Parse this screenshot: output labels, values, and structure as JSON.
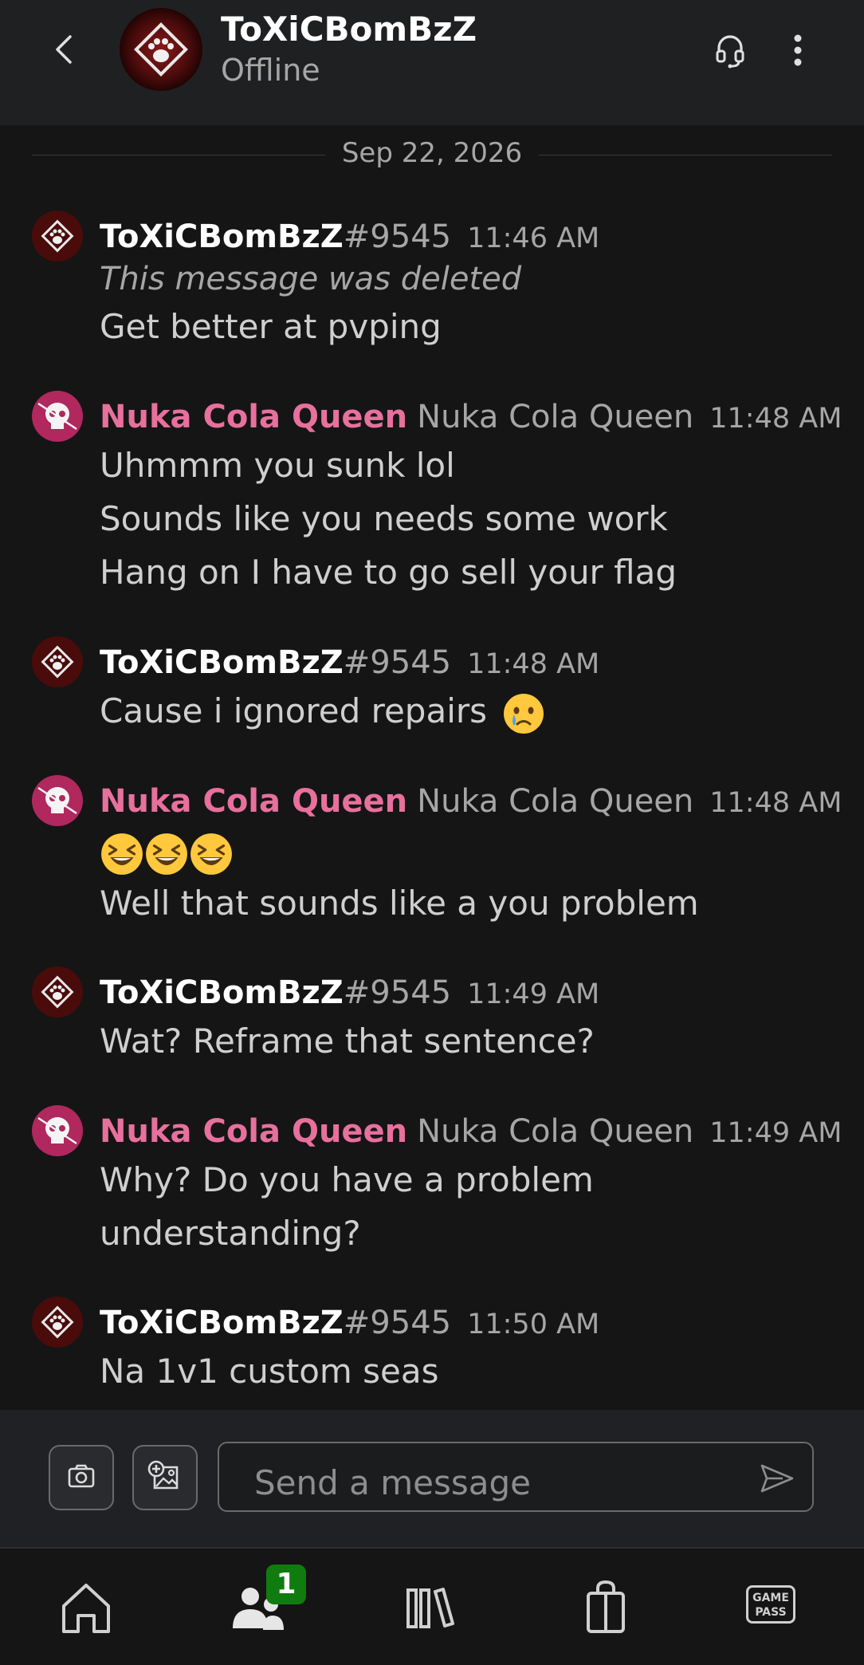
{
  "header": {
    "name": "ToXiCBomBzZ",
    "status": "Offline"
  },
  "date_separator": "Sep 22, 2026",
  "messages": [
    {
      "sender": "ToXiCBomBzZ",
      "tag": "#9545",
      "time": "11:46 AM",
      "deleted": "This message was deleted",
      "lines": [
        "Get better at pvping"
      ]
    },
    {
      "sender": "Nuka Cola Queen",
      "gamertag": "Nuka Cola Queen",
      "time": "11:48 AM",
      "lines": [
        "Uhmmm you sunk lol",
        "Sounds like you needs some work",
        "Hang on I have to go sell your flag"
      ]
    },
    {
      "sender": "ToXiCBomBzZ",
      "tag": "#9545",
      "time": "11:48 AM",
      "lines": [
        "Cause i ignored repairs"
      ],
      "emoji": "crying-face"
    },
    {
      "sender": "Nuka Cola Queen",
      "gamertag": "Nuka Cola Queen",
      "time": "11:48 AM",
      "emoji_line": [
        "grinning-squinting-face",
        "grinning-squinting-face",
        "grinning-squinting-face"
      ],
      "lines": [
        "Well that sounds like a you problem"
      ]
    },
    {
      "sender": "ToXiCBomBzZ",
      "tag": "#9545",
      "time": "11:49 AM",
      "lines": [
        "Wat? Reframe that sentence?"
      ]
    },
    {
      "sender": "Nuka Cola Queen",
      "gamertag": "Nuka Cola Queen",
      "time": "11:49 AM",
      "lines": [
        "Why? Do you have a problem",
        "understanding?"
      ]
    },
    {
      "sender": "ToXiCBomBzZ",
      "tag": "#9545",
      "time": "11:50 AM",
      "lines": [
        "Na 1v1 custom seas"
      ]
    }
  ],
  "composer": {
    "placeholder": "Send a message"
  },
  "bottom_nav": {
    "items": [
      "home-icon",
      "people-icon",
      "library-icon",
      "store-icon",
      "game-pass-icon"
    ],
    "people_badge": "1",
    "game_pass_text_1": "GAME",
    "game_pass_text_2": "PASS"
  },
  "colors": {
    "background": "#151515",
    "header": "#1f2022",
    "other_user_name": "#e7709c",
    "badge": "#107c10"
  }
}
